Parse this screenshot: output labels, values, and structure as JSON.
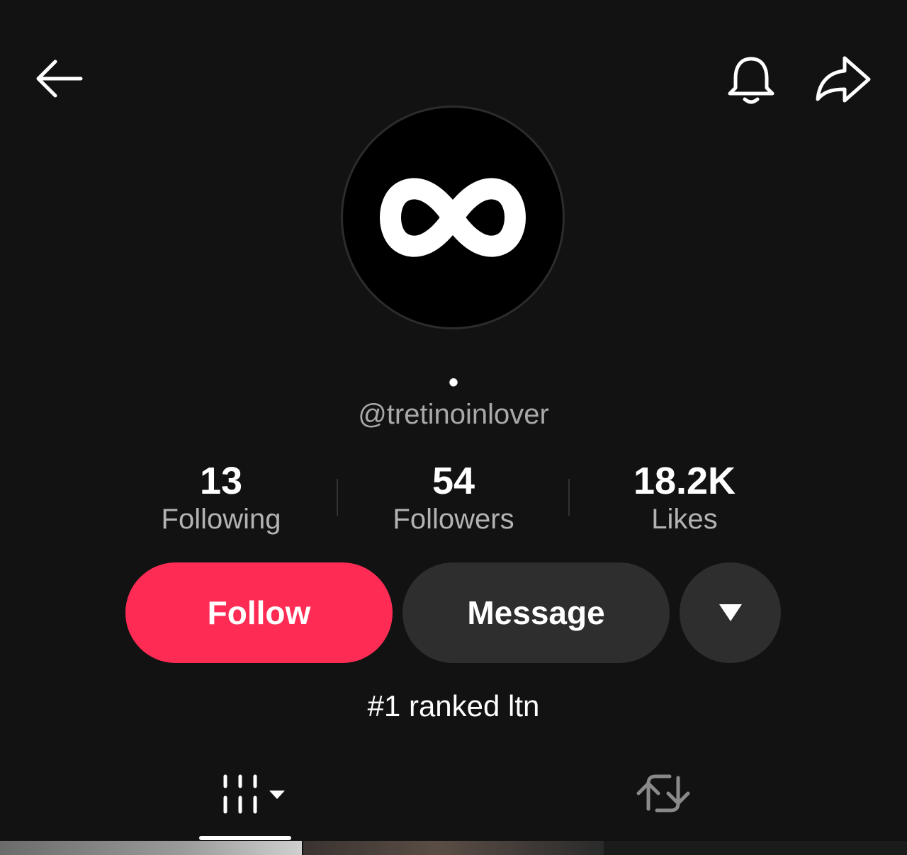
{
  "profile": {
    "display_name": "•",
    "username": "@tretinoinlover",
    "bio": "#1 ranked ltn"
  },
  "stats": {
    "following": {
      "count": "13",
      "label": "Following"
    },
    "followers": {
      "count": "54",
      "label": "Followers"
    },
    "likes": {
      "count": "18.2K",
      "label": "Likes"
    }
  },
  "actions": {
    "follow_label": "Follow",
    "message_label": "Message"
  },
  "icons": {
    "back": "back-arrow-icon",
    "bell": "bell-icon",
    "share": "share-arrow-icon",
    "more": "caret-down-icon",
    "videos_tab": "videos-grid-icon",
    "reposts_tab": "repost-icon",
    "avatar_logo": "infinity-logo"
  },
  "colors": {
    "background": "#121212",
    "accent": "#fe2c55",
    "secondary_button": "#2e2e2e",
    "muted_text": "#a9a9a9"
  },
  "tabs": {
    "active": "videos"
  }
}
